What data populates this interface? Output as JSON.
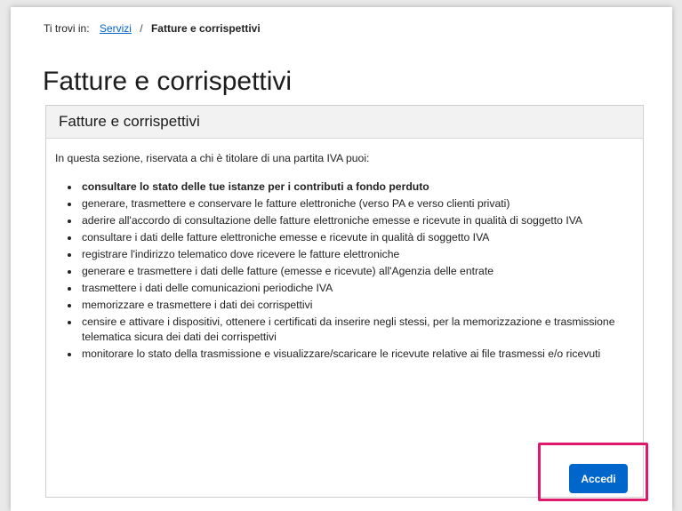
{
  "breadcrumb": {
    "prefix": "Ti trovi in:",
    "link": "Servizi",
    "separator": "/",
    "current": "Fatture e corrispettivi"
  },
  "page_title": "Fatture e corrispettivi",
  "card": {
    "header": "Fatture e corrispettivi",
    "intro": "In questa sezione, riservata a chi è titolare di una partita IVA puoi:",
    "items": [
      "consultare lo stato delle tue istanze per i contributi a fondo perduto",
      "generare, trasmettere e conservare le fatture elettroniche (verso PA e verso clienti privati)",
      "aderire all'accordo di consultazione delle fatture elettroniche emesse e ricevute in qualità di soggetto IVA",
      "consultare i dati delle fatture elettroniche emesse e ricevute in qualità di soggetto IVA",
      "registrare l'indirizzo telematico dove ricevere le fatture elettroniche",
      "generare e trasmettere i dati delle fatture (emesse e ricevute) all'Agenzia delle entrate",
      "trasmettere i dati delle comunicazioni periodiche IVA",
      "memorizzare e trasmettere i dati dei corrispettivi",
      "censire e attivare i dispositivi, ottenere i certificati da inserire negli stessi, per la memorizzazione e trasmissione telematica sicura dei dati dei corrispettivi",
      "monitorare lo stato della trasmissione e visualizzare/scaricare le ricevute relative ai file trasmessi e/o ricevuti"
    ]
  },
  "accedi_button": "Accedi",
  "colors": {
    "link": "#0066cc",
    "button": "#0066cc",
    "highlight": "#e0186c",
    "card_header_bg": "#f2f2f2"
  }
}
